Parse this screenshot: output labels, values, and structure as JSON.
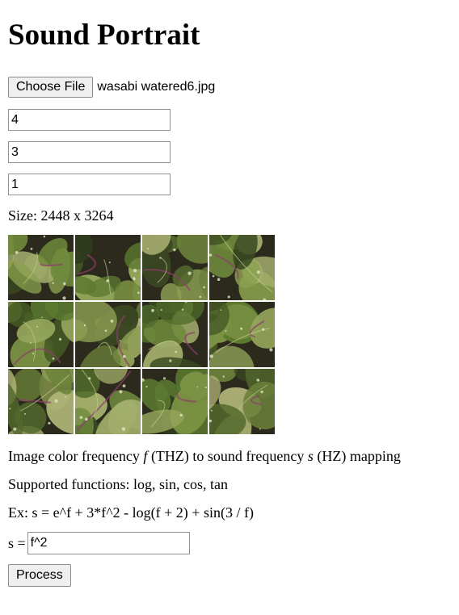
{
  "title": "Sound Portrait",
  "file": {
    "button_label": "Choose File",
    "file_name": "wasabi watered6.jpg"
  },
  "inputs": {
    "field1": "4",
    "field2": "3",
    "field3": "1"
  },
  "size_text": "Size: 2448 x 3264",
  "image_grid": {
    "rows": 3,
    "cols": 4,
    "description_icon": "wasabi-leaf-photo-tile"
  },
  "mapping": {
    "prefix": "Image color frequency ",
    "f": "f",
    "middle": " (THZ) to sound frequency ",
    "s": "s",
    "suffix": " (HZ) mapping"
  },
  "supported_text": "Supported functions: log, sin, cos, tan",
  "example_text": "Ex: s = e^f + 3*f^2 - log(f + 2) + sin(3 / f)",
  "formula": {
    "label": "s =",
    "value": "f^2"
  },
  "process_label": "Process"
}
